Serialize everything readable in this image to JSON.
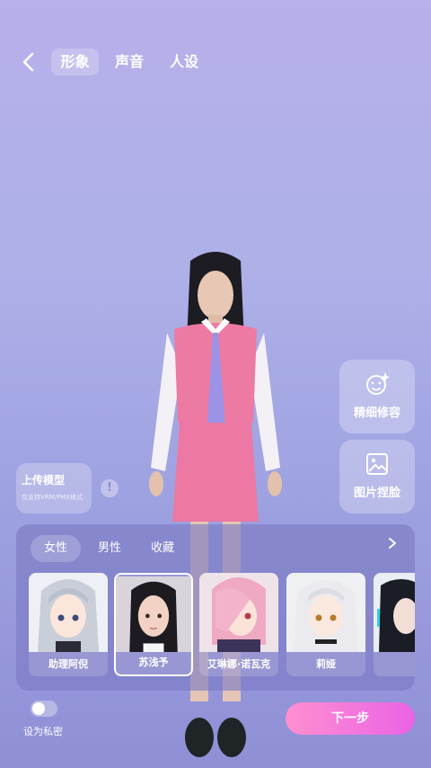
{
  "nav": {
    "tabs": [
      {
        "label": "形象",
        "active": true
      },
      {
        "label": "声音",
        "active": false
      },
      {
        "label": "人设",
        "active": false
      }
    ]
  },
  "side_actions": {
    "refine_label": "精细修容",
    "photo_label": "图片捏脸"
  },
  "upload": {
    "title": "上传模型",
    "subtitle": "仅支持VRM/PMX格式"
  },
  "gallery": {
    "tabs": [
      {
        "label": "女性",
        "active": true
      },
      {
        "label": "男性",
        "active": false
      },
      {
        "label": "收藏",
        "active": false
      }
    ],
    "characters": [
      {
        "name": "助理阿倪",
        "selected": false
      },
      {
        "name": "苏浅予",
        "selected": true
      },
      {
        "name": "艾琳娜·诺瓦克",
        "selected": false
      },
      {
        "name": "莉娅",
        "selected": false
      },
      {
        "name": "",
        "selected": false
      }
    ]
  },
  "footer": {
    "private_label": "设为私密",
    "private_on": false,
    "next_label": "下一步"
  },
  "colors": {
    "accent_start": "#ff8fd0",
    "accent_end": "#ea63e6",
    "background_top": "#b7b0ea",
    "background_bottom": "#8f8fd6"
  }
}
